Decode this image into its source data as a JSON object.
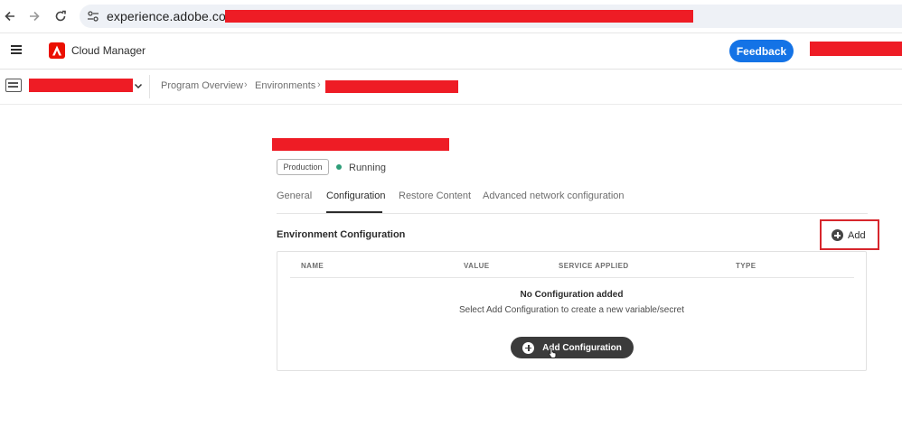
{
  "browser": {
    "url": "experience.adobe.com/#",
    "icons": [
      "back-arrow-icon",
      "forward-arrow-icon",
      "reload-icon",
      "site-info-icon"
    ]
  },
  "header": {
    "app_title": "Cloud Manager",
    "feedback_label": "Feedback",
    "brand_color": "#eb1000",
    "accent_color": "#1473e6"
  },
  "breadcrumb": {
    "items": [
      "Program Overview",
      "Environments"
    ],
    "separator": "›"
  },
  "environment": {
    "type_tag": "Production",
    "status": "Running",
    "status_color": "#2d9d78"
  },
  "tabs": [
    {
      "label": "General"
    },
    {
      "label": "Configuration"
    },
    {
      "label": "Restore Content"
    },
    {
      "label": "Advanced network configuration"
    }
  ],
  "active_tab": "Configuration",
  "config_section": {
    "title": "Environment Configuration",
    "add_label": "Add",
    "columns": [
      "NAME",
      "VALUE",
      "SERVICE APPLIED",
      "TYPE"
    ],
    "empty_title": "No Configuration added",
    "empty_subtitle": "Select Add Configuration to create a new variable/secret",
    "add_config_label": "Add Configuration"
  }
}
